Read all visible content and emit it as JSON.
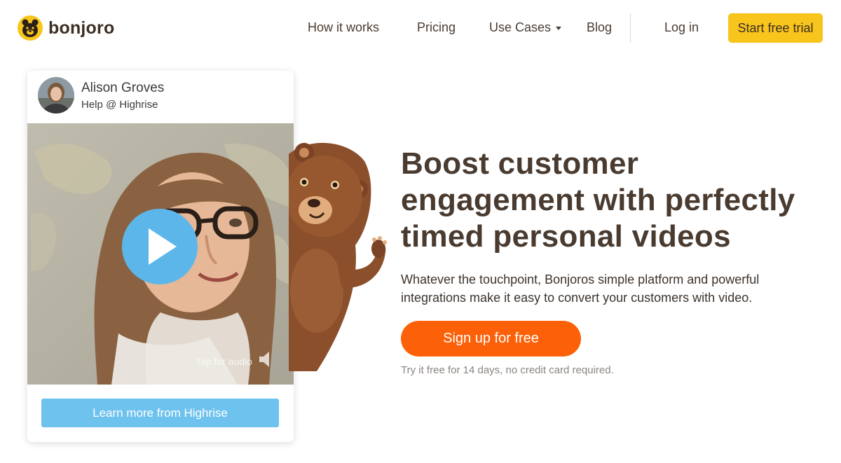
{
  "brand": {
    "name": "bonjoro",
    "accent": "#f8c51c"
  },
  "nav": {
    "links": [
      "How it works",
      "Pricing",
      "Use Cases",
      "Blog"
    ],
    "login": "Log in",
    "cta": "Start free trial"
  },
  "video_card": {
    "person_name": "Alison Groves",
    "person_role": "Help @ Highrise",
    "audio_hint": "Tap for audio",
    "learn_more": "Learn more from Highrise",
    "play_color": "#5db6ea",
    "button_color": "#6ec2ee"
  },
  "hero": {
    "headline": "Boost customer engagement with perfectly timed personal videos",
    "subhead": "Whatever the touchpoint, Bonjoros simple platform and powerful integrations make it easy to convert your customers with video.",
    "cta": "Sign up for free",
    "cta_color": "#fc6008",
    "fineprint": "Try it free for 14 days, no credit card required."
  }
}
